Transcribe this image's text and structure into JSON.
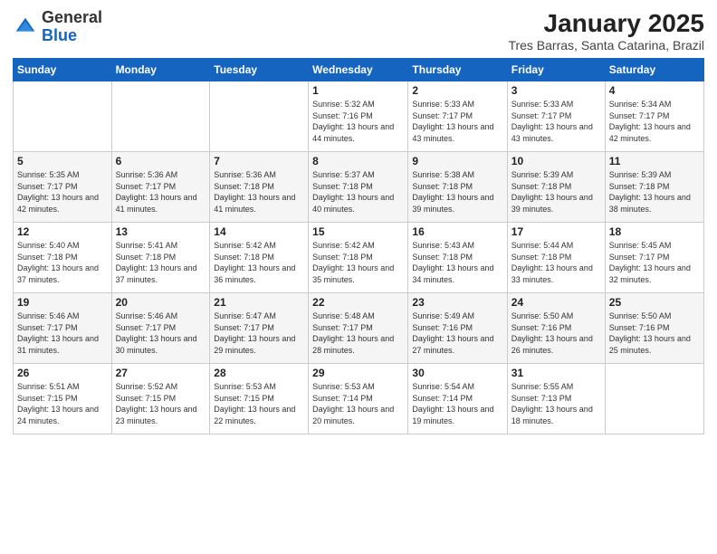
{
  "header": {
    "logo_general": "General",
    "logo_blue": "Blue",
    "month_title": "January 2025",
    "subtitle": "Tres Barras, Santa Catarina, Brazil"
  },
  "weekdays": [
    "Sunday",
    "Monday",
    "Tuesday",
    "Wednesday",
    "Thursday",
    "Friday",
    "Saturday"
  ],
  "weeks": [
    [
      {
        "day": "",
        "sunrise": "",
        "sunset": "",
        "daylight": ""
      },
      {
        "day": "",
        "sunrise": "",
        "sunset": "",
        "daylight": ""
      },
      {
        "day": "",
        "sunrise": "",
        "sunset": "",
        "daylight": ""
      },
      {
        "day": "1",
        "sunrise": "Sunrise: 5:32 AM",
        "sunset": "Sunset: 7:16 PM",
        "daylight": "Daylight: 13 hours and 44 minutes."
      },
      {
        "day": "2",
        "sunrise": "Sunrise: 5:33 AM",
        "sunset": "Sunset: 7:17 PM",
        "daylight": "Daylight: 13 hours and 43 minutes."
      },
      {
        "day": "3",
        "sunrise": "Sunrise: 5:33 AM",
        "sunset": "Sunset: 7:17 PM",
        "daylight": "Daylight: 13 hours and 43 minutes."
      },
      {
        "day": "4",
        "sunrise": "Sunrise: 5:34 AM",
        "sunset": "Sunset: 7:17 PM",
        "daylight": "Daylight: 13 hours and 42 minutes."
      }
    ],
    [
      {
        "day": "5",
        "sunrise": "Sunrise: 5:35 AM",
        "sunset": "Sunset: 7:17 PM",
        "daylight": "Daylight: 13 hours and 42 minutes."
      },
      {
        "day": "6",
        "sunrise": "Sunrise: 5:36 AM",
        "sunset": "Sunset: 7:17 PM",
        "daylight": "Daylight: 13 hours and 41 minutes."
      },
      {
        "day": "7",
        "sunrise": "Sunrise: 5:36 AM",
        "sunset": "Sunset: 7:18 PM",
        "daylight": "Daylight: 13 hours and 41 minutes."
      },
      {
        "day": "8",
        "sunrise": "Sunrise: 5:37 AM",
        "sunset": "Sunset: 7:18 PM",
        "daylight": "Daylight: 13 hours and 40 minutes."
      },
      {
        "day": "9",
        "sunrise": "Sunrise: 5:38 AM",
        "sunset": "Sunset: 7:18 PM",
        "daylight": "Daylight: 13 hours and 39 minutes."
      },
      {
        "day": "10",
        "sunrise": "Sunrise: 5:39 AM",
        "sunset": "Sunset: 7:18 PM",
        "daylight": "Daylight: 13 hours and 39 minutes."
      },
      {
        "day": "11",
        "sunrise": "Sunrise: 5:39 AM",
        "sunset": "Sunset: 7:18 PM",
        "daylight": "Daylight: 13 hours and 38 minutes."
      }
    ],
    [
      {
        "day": "12",
        "sunrise": "Sunrise: 5:40 AM",
        "sunset": "Sunset: 7:18 PM",
        "daylight": "Daylight: 13 hours and 37 minutes."
      },
      {
        "day": "13",
        "sunrise": "Sunrise: 5:41 AM",
        "sunset": "Sunset: 7:18 PM",
        "daylight": "Daylight: 13 hours and 37 minutes."
      },
      {
        "day": "14",
        "sunrise": "Sunrise: 5:42 AM",
        "sunset": "Sunset: 7:18 PM",
        "daylight": "Daylight: 13 hours and 36 minutes."
      },
      {
        "day": "15",
        "sunrise": "Sunrise: 5:42 AM",
        "sunset": "Sunset: 7:18 PM",
        "daylight": "Daylight: 13 hours and 35 minutes."
      },
      {
        "day": "16",
        "sunrise": "Sunrise: 5:43 AM",
        "sunset": "Sunset: 7:18 PM",
        "daylight": "Daylight: 13 hours and 34 minutes."
      },
      {
        "day": "17",
        "sunrise": "Sunrise: 5:44 AM",
        "sunset": "Sunset: 7:18 PM",
        "daylight": "Daylight: 13 hours and 33 minutes."
      },
      {
        "day": "18",
        "sunrise": "Sunrise: 5:45 AM",
        "sunset": "Sunset: 7:17 PM",
        "daylight": "Daylight: 13 hours and 32 minutes."
      }
    ],
    [
      {
        "day": "19",
        "sunrise": "Sunrise: 5:46 AM",
        "sunset": "Sunset: 7:17 PM",
        "daylight": "Daylight: 13 hours and 31 minutes."
      },
      {
        "day": "20",
        "sunrise": "Sunrise: 5:46 AM",
        "sunset": "Sunset: 7:17 PM",
        "daylight": "Daylight: 13 hours and 30 minutes."
      },
      {
        "day": "21",
        "sunrise": "Sunrise: 5:47 AM",
        "sunset": "Sunset: 7:17 PM",
        "daylight": "Daylight: 13 hours and 29 minutes."
      },
      {
        "day": "22",
        "sunrise": "Sunrise: 5:48 AM",
        "sunset": "Sunset: 7:17 PM",
        "daylight": "Daylight: 13 hours and 28 minutes."
      },
      {
        "day": "23",
        "sunrise": "Sunrise: 5:49 AM",
        "sunset": "Sunset: 7:16 PM",
        "daylight": "Daylight: 13 hours and 27 minutes."
      },
      {
        "day": "24",
        "sunrise": "Sunrise: 5:50 AM",
        "sunset": "Sunset: 7:16 PM",
        "daylight": "Daylight: 13 hours and 26 minutes."
      },
      {
        "day": "25",
        "sunrise": "Sunrise: 5:50 AM",
        "sunset": "Sunset: 7:16 PM",
        "daylight": "Daylight: 13 hours and 25 minutes."
      }
    ],
    [
      {
        "day": "26",
        "sunrise": "Sunrise: 5:51 AM",
        "sunset": "Sunset: 7:15 PM",
        "daylight": "Daylight: 13 hours and 24 minutes."
      },
      {
        "day": "27",
        "sunrise": "Sunrise: 5:52 AM",
        "sunset": "Sunset: 7:15 PM",
        "daylight": "Daylight: 13 hours and 23 minutes."
      },
      {
        "day": "28",
        "sunrise": "Sunrise: 5:53 AM",
        "sunset": "Sunset: 7:15 PM",
        "daylight": "Daylight: 13 hours and 22 minutes."
      },
      {
        "day": "29",
        "sunrise": "Sunrise: 5:53 AM",
        "sunset": "Sunset: 7:14 PM",
        "daylight": "Daylight: 13 hours and 20 minutes."
      },
      {
        "day": "30",
        "sunrise": "Sunrise: 5:54 AM",
        "sunset": "Sunset: 7:14 PM",
        "daylight": "Daylight: 13 hours and 19 minutes."
      },
      {
        "day": "31",
        "sunrise": "Sunrise: 5:55 AM",
        "sunset": "Sunset: 7:13 PM",
        "daylight": "Daylight: 13 hours and 18 minutes."
      },
      {
        "day": "",
        "sunrise": "",
        "sunset": "",
        "daylight": ""
      }
    ]
  ]
}
